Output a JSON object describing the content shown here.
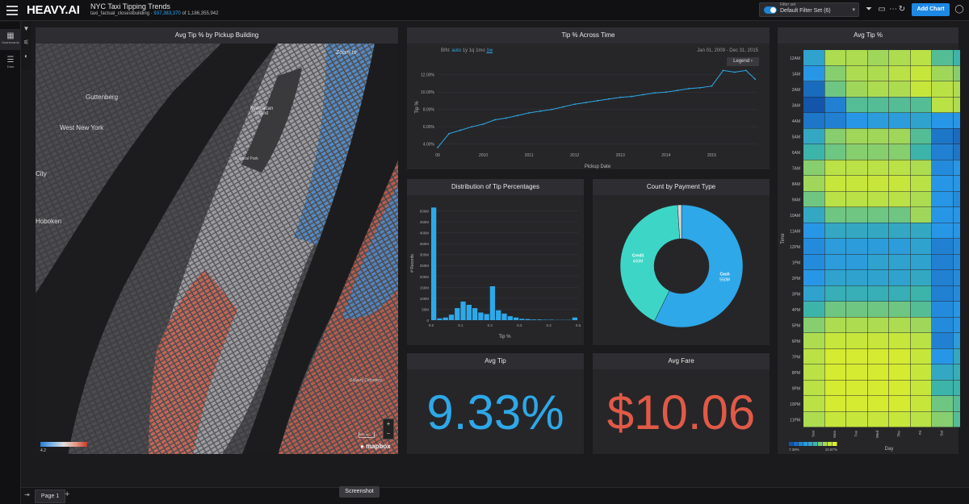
{
  "app": {
    "logo": "HEAVY.AI",
    "dashboard_title": "NYC Taxi Tipping Trends",
    "table_name": "taxi_factual_closestbuilding",
    "row_count_filtered": "937,383,370",
    "row_count_total": "of 1,186,355,942",
    "filter_set_label": "Filter set",
    "filter_set_value": "Default Filter Set (6)",
    "add_chart_label": "Add Chart"
  },
  "sidebar": {
    "items": [
      {
        "label": "Dashboards",
        "icon": "dashboard-icon"
      },
      {
        "label": "Data",
        "icon": "data-icon"
      }
    ]
  },
  "map_panel": {
    "title": "Avg Tip % by Pickup Building",
    "places": [
      "Guttenberg",
      "West New York",
      "Manhattan Island",
      "Central Park",
      "City",
      "Hoboken",
      "Calvary Cemetery"
    ],
    "zoom_label": "Zoom to",
    "legend_min": "4.2",
    "scale_label": "500 m",
    "attribution": "mapbox"
  },
  "line_panel": {
    "title": "Tip % Across Time",
    "bin_label": "BIN:",
    "bin_options": [
      "auto",
      "1y",
      "1q",
      "1mo",
      "1w"
    ],
    "date_range": "Jan 01, 2009 - Dec 31, 2015",
    "legend_button": "Legend"
  },
  "hist_panel": {
    "title": "Distribution of Tip Percentages"
  },
  "pie_panel": {
    "title": "Count by Payment Type"
  },
  "heat_panel": {
    "title": "Avg Tip %"
  },
  "kpi_tip": {
    "title": "Avg Tip",
    "value": "9.33%",
    "color": "#2ea8e8"
  },
  "kpi_fare": {
    "title": "Avg Fare",
    "value": "$10.06",
    "color": "#e05a47"
  },
  "bottom": {
    "page_tab": "Page 1",
    "tooltip": "Screenshot"
  },
  "chart_data": [
    {
      "type": "line",
      "title": "Tip % Across Time",
      "xlabel": "Pickup Date",
      "ylabel": "Tip %",
      "x_ticks": [
        "09",
        "2010",
        "2011",
        "2012",
        "2013",
        "2014",
        "2015"
      ],
      "y_ticks": [
        "4.00%",
        "6.00%",
        "8.00%",
        "10.00%",
        "12.00%"
      ],
      "ylim": [
        3.5,
        13
      ],
      "color": "#2ea8e8",
      "x": [
        2009.0,
        2009.25,
        2009.5,
        2009.75,
        2010.0,
        2010.25,
        2010.5,
        2010.75,
        2011.0,
        2011.25,
        2011.5,
        2011.75,
        2012.0,
        2012.25,
        2012.5,
        2012.75,
        2013.0,
        2013.25,
        2013.5,
        2013.75,
        2014.0,
        2014.25,
        2014.5,
        2014.75,
        2015.0,
        2015.25,
        2015.5,
        2015.75,
        2015.95
      ],
      "values": [
        3.6,
        5.2,
        5.6,
        6.0,
        6.3,
        6.8,
        7.0,
        7.3,
        7.6,
        7.8,
        8.0,
        8.3,
        8.6,
        8.8,
        9.0,
        9.2,
        9.4,
        9.5,
        9.7,
        9.9,
        10.0,
        10.2,
        10.4,
        10.5,
        10.7,
        12.5,
        12.3,
        12.5,
        11.5
      ]
    },
    {
      "type": "bar",
      "title": "Distribution of Tip Percentages",
      "xlabel": "Tip %",
      "ylabel": "# Records",
      "x_ticks": [
        "0.0",
        "0.1",
        "0.2",
        "0.3",
        "0.4",
        "0.5"
      ],
      "y_ticks": [
        "0",
        "50M",
        "100M",
        "150M",
        "200M",
        "250M",
        "300M",
        "350M",
        "400M",
        "450M",
        "500M"
      ],
      "ylim": [
        0,
        520
      ],
      "bin_width": 0.02,
      "categories": [
        "0.00",
        "0.02",
        "0.04",
        "0.06",
        "0.08",
        "0.10",
        "0.12",
        "0.14",
        "0.16",
        "0.18",
        "0.20",
        "0.22",
        "0.24",
        "0.26",
        "0.28",
        "0.30",
        "0.32",
        "0.34",
        "0.36",
        "0.38",
        "0.40",
        "0.42",
        "0.44",
        "0.46",
        "0.48"
      ],
      "values": [
        515,
        8,
        12,
        25,
        55,
        85,
        70,
        55,
        35,
        28,
        155,
        45,
        30,
        18,
        12,
        6,
        5,
        3,
        3,
        2,
        2,
        1,
        1,
        1,
        12
      ]
    },
    {
      "type": "pie",
      "title": "Count by Payment Type",
      "labels": [
        "Cash",
        "Credit",
        "Other"
      ],
      "label_values": [
        "550M",
        "400M",
        ""
      ],
      "values": [
        550,
        400,
        10
      ],
      "colors": [
        "#2ea8e8",
        "#3dd6c6",
        "#d8d8d8"
      ]
    },
    {
      "type": "heatmap",
      "title": "Avg Tip %",
      "xlabel": "Day",
      "ylabel": "Time",
      "x": [
        "Sun",
        "Mon",
        "Tue",
        "Wed",
        "Thu",
        "Fri",
        "Sat",
        "Sun"
      ],
      "y": [
        "12AM",
        "1AM",
        "2AM",
        "3AM",
        "4AM",
        "5AM",
        "6AM",
        "7AM",
        "8AM",
        "9AM",
        "10AM",
        "11AM",
        "12PM",
        "1PM",
        "2PM",
        "3PM",
        "4PM",
        "5PM",
        "6PM",
        "7PM",
        "8PM",
        "9PM",
        "10PM",
        "11PM"
      ],
      "legend_min": "7.38%",
      "legend_max": "10.87%",
      "values": [
        [
          0.4,
          0.8,
          0.8,
          0.75,
          0.8,
          0.85,
          0.6,
          0.55
        ],
        [
          0.3,
          0.7,
          0.8,
          0.8,
          0.85,
          0.9,
          0.75,
          0.7
        ],
        [
          0.1,
          0.65,
          0.75,
          0.8,
          0.8,
          0.9,
          0.85,
          0.8
        ],
        [
          0.0,
          0.2,
          0.6,
          0.6,
          0.6,
          0.6,
          0.85,
          0.8
        ],
        [
          0.15,
          0.2,
          0.3,
          0.35,
          0.35,
          0.4,
          0.3,
          0.3
        ],
        [
          0.45,
          0.7,
          0.75,
          0.75,
          0.75,
          0.6,
          0.15,
          0.1
        ],
        [
          0.55,
          0.65,
          0.7,
          0.7,
          0.7,
          0.55,
          0.2,
          0.15
        ],
        [
          0.7,
          0.85,
          0.85,
          0.85,
          0.85,
          0.8,
          0.25,
          0.3
        ],
        [
          0.75,
          0.9,
          0.9,
          0.9,
          0.9,
          0.85,
          0.3,
          0.3
        ],
        [
          0.65,
          0.85,
          0.85,
          0.85,
          0.85,
          0.8,
          0.3,
          0.25
        ],
        [
          0.45,
          0.65,
          0.65,
          0.65,
          0.65,
          0.75,
          0.3,
          0.3
        ],
        [
          0.3,
          0.45,
          0.45,
          0.45,
          0.45,
          0.45,
          0.3,
          0.3
        ],
        [
          0.25,
          0.35,
          0.35,
          0.35,
          0.35,
          0.4,
          0.2,
          0.25
        ],
        [
          0.25,
          0.35,
          0.35,
          0.4,
          0.4,
          0.4,
          0.2,
          0.25
        ],
        [
          0.3,
          0.4,
          0.4,
          0.4,
          0.4,
          0.45,
          0.2,
          0.25
        ],
        [
          0.4,
          0.5,
          0.5,
          0.5,
          0.5,
          0.55,
          0.2,
          0.25
        ],
        [
          0.55,
          0.65,
          0.65,
          0.65,
          0.65,
          0.6,
          0.25,
          0.3
        ],
        [
          0.7,
          0.8,
          0.8,
          0.8,
          0.8,
          0.75,
          0.25,
          0.3
        ],
        [
          0.8,
          0.9,
          0.9,
          0.9,
          0.9,
          0.85,
          0.2,
          0.35
        ],
        [
          0.85,
          0.95,
          0.95,
          0.95,
          0.95,
          0.9,
          0.3,
          0.45
        ],
        [
          0.85,
          0.95,
          0.95,
          0.95,
          0.95,
          0.9,
          0.45,
          0.5
        ],
        [
          0.85,
          0.95,
          0.95,
          0.95,
          0.95,
          0.9,
          0.55,
          0.55
        ],
        [
          0.85,
          0.95,
          0.95,
          0.95,
          0.95,
          0.9,
          0.65,
          0.6
        ],
        [
          0.8,
          0.9,
          0.9,
          0.9,
          0.9,
          0.85,
          0.7,
          0.6
        ]
      ]
    }
  ]
}
